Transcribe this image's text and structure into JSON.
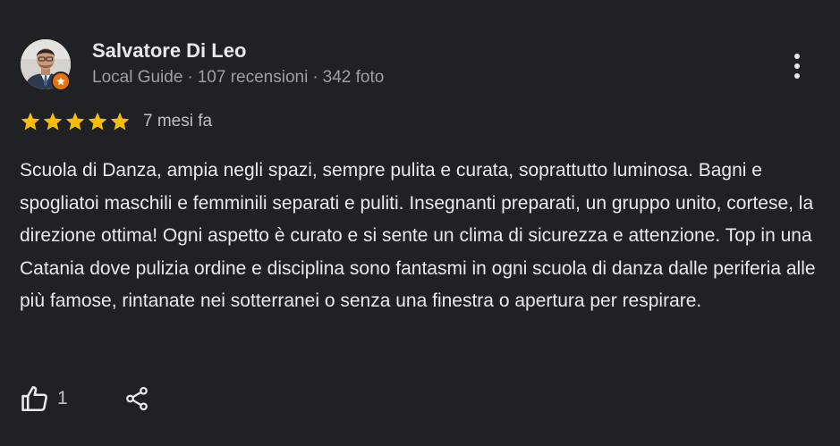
{
  "reviewer": {
    "name": "Salvatore Di Leo",
    "role": "Local Guide",
    "separator": "·",
    "reviews_count": "107 recensioni",
    "photos_count": "342 foto",
    "badge_icon": "local-guide-star-icon",
    "badge_color": "#e8710a"
  },
  "rating": {
    "stars": 5,
    "max_stars": 5,
    "star_color": "#fbbc04",
    "date": "7 mesi fa"
  },
  "review_text": "Scuola di Danza, ampia negli spazi, sempre pulita e curata, soprattutto luminosa. Bagni e spogliatoi maschili e femminili separati e puliti. Insegnanti preparati, un gruppo unito, cortese, la direzione ottima! Ogni aspetto è curato e si sente un clima di sicurezza e attenzione. Top in una Catania dove pulizia ordine e disciplina sono fantasmi in ogni scuola di danza dalle periferia alle più famose, rintanate nei sotterranei o senza una finestra o apertura per respirare.",
  "actions": {
    "like_icon": "thumbs-up-icon",
    "like_count": "1",
    "share_icon": "share-icon",
    "more_icon": "more-vertical-icon"
  },
  "colors": {
    "background": "#202124",
    "text_primary": "#e8eaed",
    "text_secondary": "#9aa0a6"
  }
}
